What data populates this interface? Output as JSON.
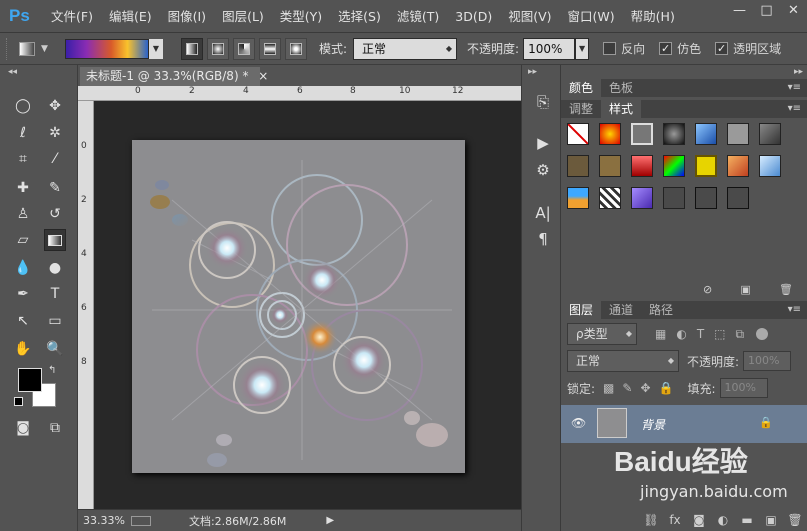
{
  "app": {
    "logo": "Ps",
    "window_controls": [
      "—",
      "□",
      "✕"
    ]
  },
  "menu": [
    "文件(F)",
    "编辑(E)",
    "图像(I)",
    "图层(L)",
    "类型(Y)",
    "选择(S)",
    "滤镜(T)",
    "3D(D)",
    "视图(V)",
    "窗口(W)",
    "帮助(H)"
  ],
  "options": {
    "mode_label": "模式:",
    "mode_value": "正常",
    "opacity_label": "不透明度:",
    "opacity_value": "100%",
    "reverse_label": "反向",
    "dither_label": "仿色",
    "transparency_label": "透明区域",
    "reverse_checked": false,
    "dither_checked": true,
    "transparency_checked": true
  },
  "document": {
    "tab_title": "未标题-1 @ 33.3%(RGB/8) *",
    "close": "×",
    "ruler_top": [
      "0",
      "2",
      "4",
      "6",
      "8",
      "10",
      "12"
    ],
    "ruler_left": [
      "0",
      "2",
      "4",
      "6",
      "8"
    ],
    "status_zoom": "33.33%",
    "status_doc": "文档:2.86M/2.86M"
  },
  "panels": {
    "color_tabs": [
      "颜色",
      "色板"
    ],
    "style_tabs": [
      "调整",
      "样式"
    ],
    "layer_tabs": [
      "图层",
      "通道",
      "路径"
    ],
    "filter_kind": "ρ类型",
    "blend_mode": "正常",
    "opacity_label": "不透明度:",
    "opacity_value": "100%",
    "lock_label": "锁定:",
    "fill_label": "填充:",
    "fill_value": "100%",
    "layer_name": "背景"
  },
  "watermark": {
    "brand": "Baidu经验",
    "url": "jingyan.baidu.com"
  }
}
